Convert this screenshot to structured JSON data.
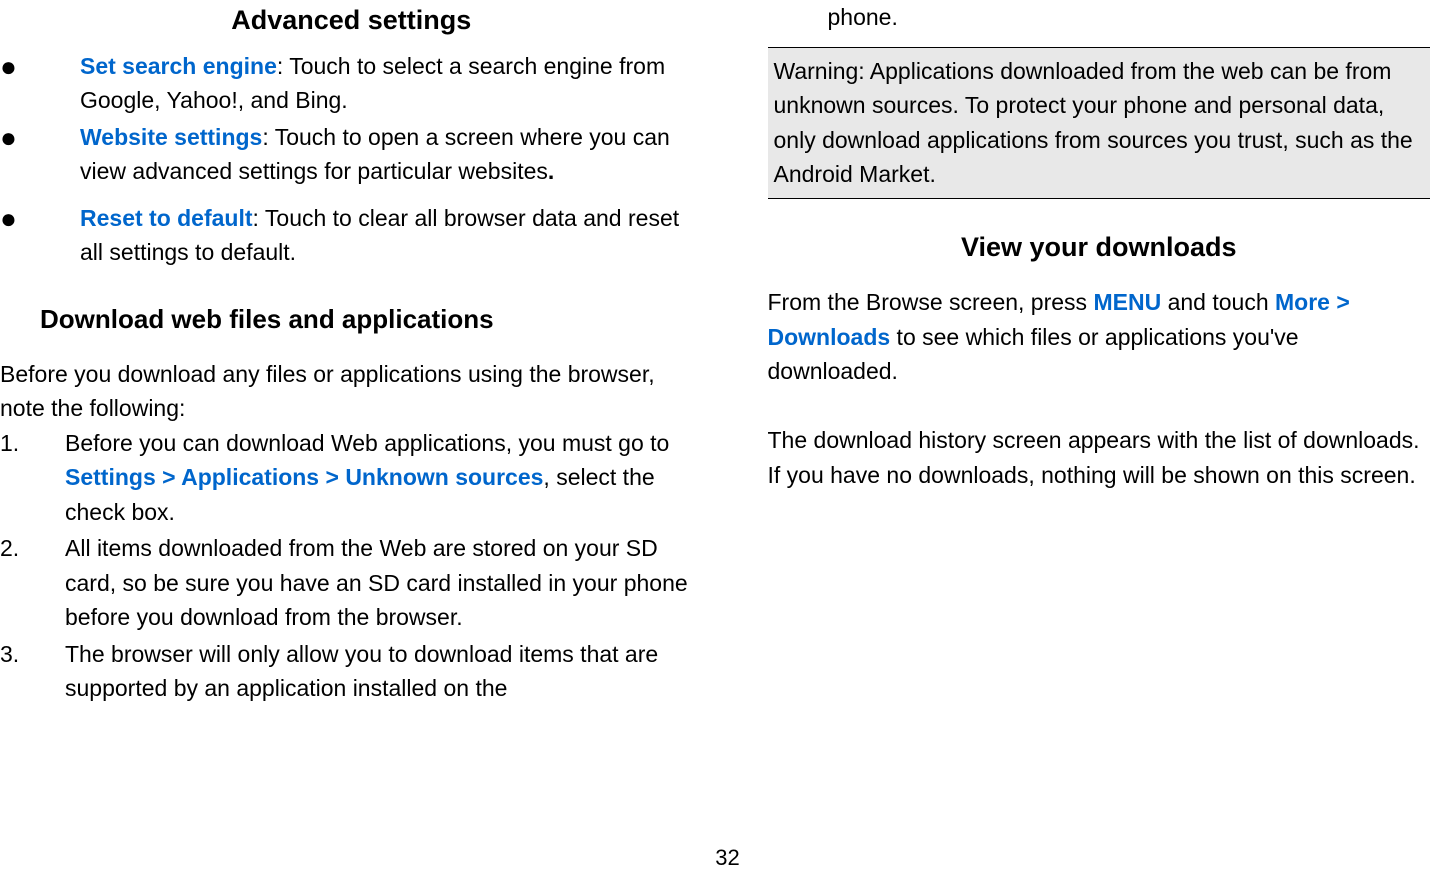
{
  "left": {
    "heading1": "Advanced settings",
    "bullet1_blue": "Set search engine",
    "bullet1_rest": ": Touch to select a search engine from Google, Yahoo!, and Bing.",
    "bullet2_blue": "Website settings",
    "bullet2_rest1": ": Touch",
    "bullet2_rest2": " to open a screen where you can view advanced settings for particular websites",
    "bullet2_dot": ".",
    "bullet3_blue": "Reset to default",
    "bullet3_rest": ": Touch to clear all browser data and reset all settings to default.",
    "heading2": "Download web files and applications",
    "para1": "Before you download any files or applications using the browser, note the following:",
    "ol1_num": "1.",
    "ol1_a": "Before you can download Web applications, you must go to ",
    "ol1_blue": "Settings > Applications > Unknown sources",
    "ol1_b": ", select the check box.",
    "ol2_num": "2.",
    "ol2": "All items downloaded from the Web are stored on your SD card, so be sure you have an SD card installed in your phone before you download from the browser.",
    "ol3_num": "3.",
    "ol3": "The browser will only allow you to download items that are supported by an application installed on the"
  },
  "right": {
    "top_line": "phone.",
    "warning": "Warning: Applications downloaded from the web can be from unknown sources. To protect your phone and personal data, only download applications from sources you trust, such as the Android Market.",
    "heading": "View your downloads",
    "para1_a": "From the Browse screen, press ",
    "para1_blue1": "MENU",
    "para1_b": " and touch ",
    "para1_blue2": "More > Downloads",
    "para1_c": " to see which files or applications you've downloaded.",
    "para2": "The download history screen appears with the list of downloads. If you have no downloads, nothing will be shown on this screen."
  },
  "page_number": "32"
}
